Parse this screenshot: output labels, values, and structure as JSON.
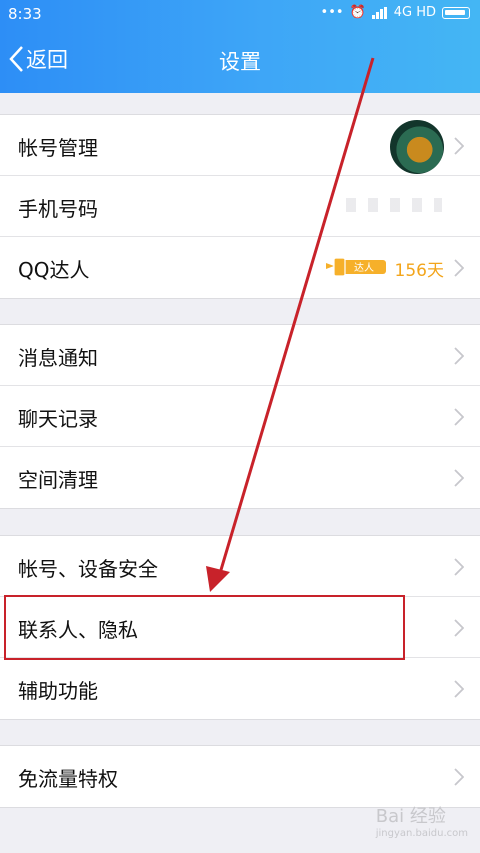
{
  "status_bar": {
    "time": "8:33",
    "network": "4G HD"
  },
  "nav": {
    "back_label": "返回",
    "title": "设置"
  },
  "groups": [
    {
      "items": [
        {
          "label": "帐号管理"
        },
        {
          "label": "手机号码"
        },
        {
          "label": "QQ达人",
          "badge_text": "达人",
          "days": "156天"
        }
      ]
    },
    {
      "items": [
        {
          "label": "消息通知"
        },
        {
          "label": "聊天记录"
        },
        {
          "label": "空间清理"
        }
      ]
    },
    {
      "items": [
        {
          "label": "帐号、设备安全"
        },
        {
          "label": "联系人、隐私"
        },
        {
          "label": "辅助功能"
        }
      ]
    },
    {
      "items": [
        {
          "label": "免流量特权"
        }
      ]
    }
  ],
  "annotation": {
    "color": "#c8222a"
  },
  "watermark": {
    "text": "Bai 经验",
    "sub": "jingyan.baidu.com"
  },
  "colors": {
    "header_start": "#2d8ef6",
    "header_end": "#44b6f4",
    "badge": "#f3a51b"
  }
}
